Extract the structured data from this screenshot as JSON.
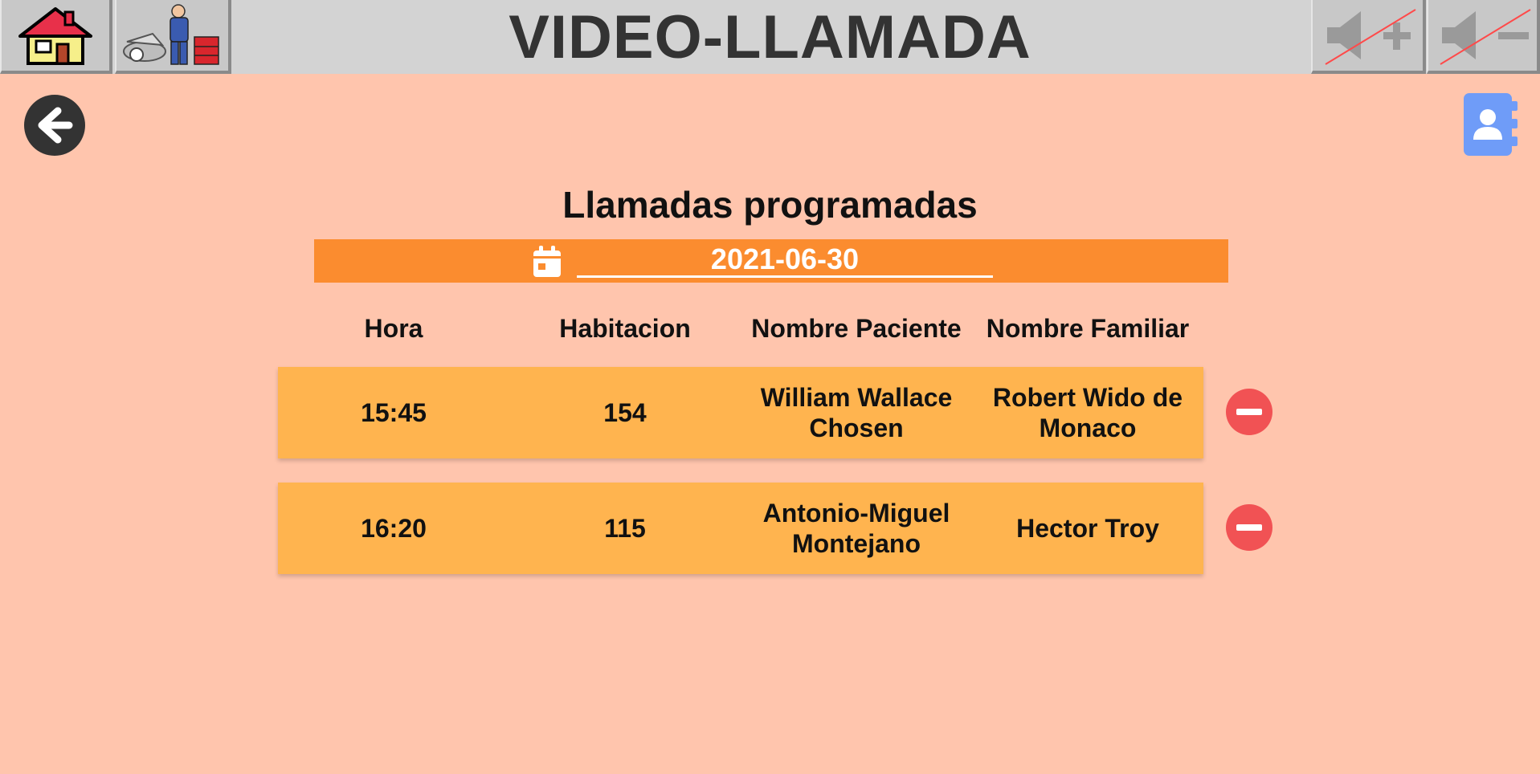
{
  "header": {
    "title": "VIDEO-LLAMADA",
    "icons": [
      "home-icon",
      "mechanic-icon",
      "volume-up-icon",
      "volume-down-icon"
    ]
  },
  "page": {
    "section_title": "Llamadas programadas",
    "date_value": "2021-06-30"
  },
  "table": {
    "headers": [
      "Hora",
      "Habitacion",
      "Nombre Paciente",
      "Nombre Familiar"
    ],
    "rows": [
      {
        "hora": "15:45",
        "habitacion": "154",
        "paciente": "William Wallace Chosen",
        "familiar": "Robert Wido de Monaco"
      },
      {
        "hora": "16:20",
        "habitacion": "115",
        "paciente": "Antonio-Miguel Montejano",
        "familiar": "Hector Troy"
      }
    ]
  },
  "colors": {
    "background": "#ffc5ad",
    "topbar": "#d3d3d3",
    "date_bar": "#fb8c2f",
    "row": "#ffb44f",
    "delete": "#f15254",
    "contacts": "#6f9cf8"
  }
}
